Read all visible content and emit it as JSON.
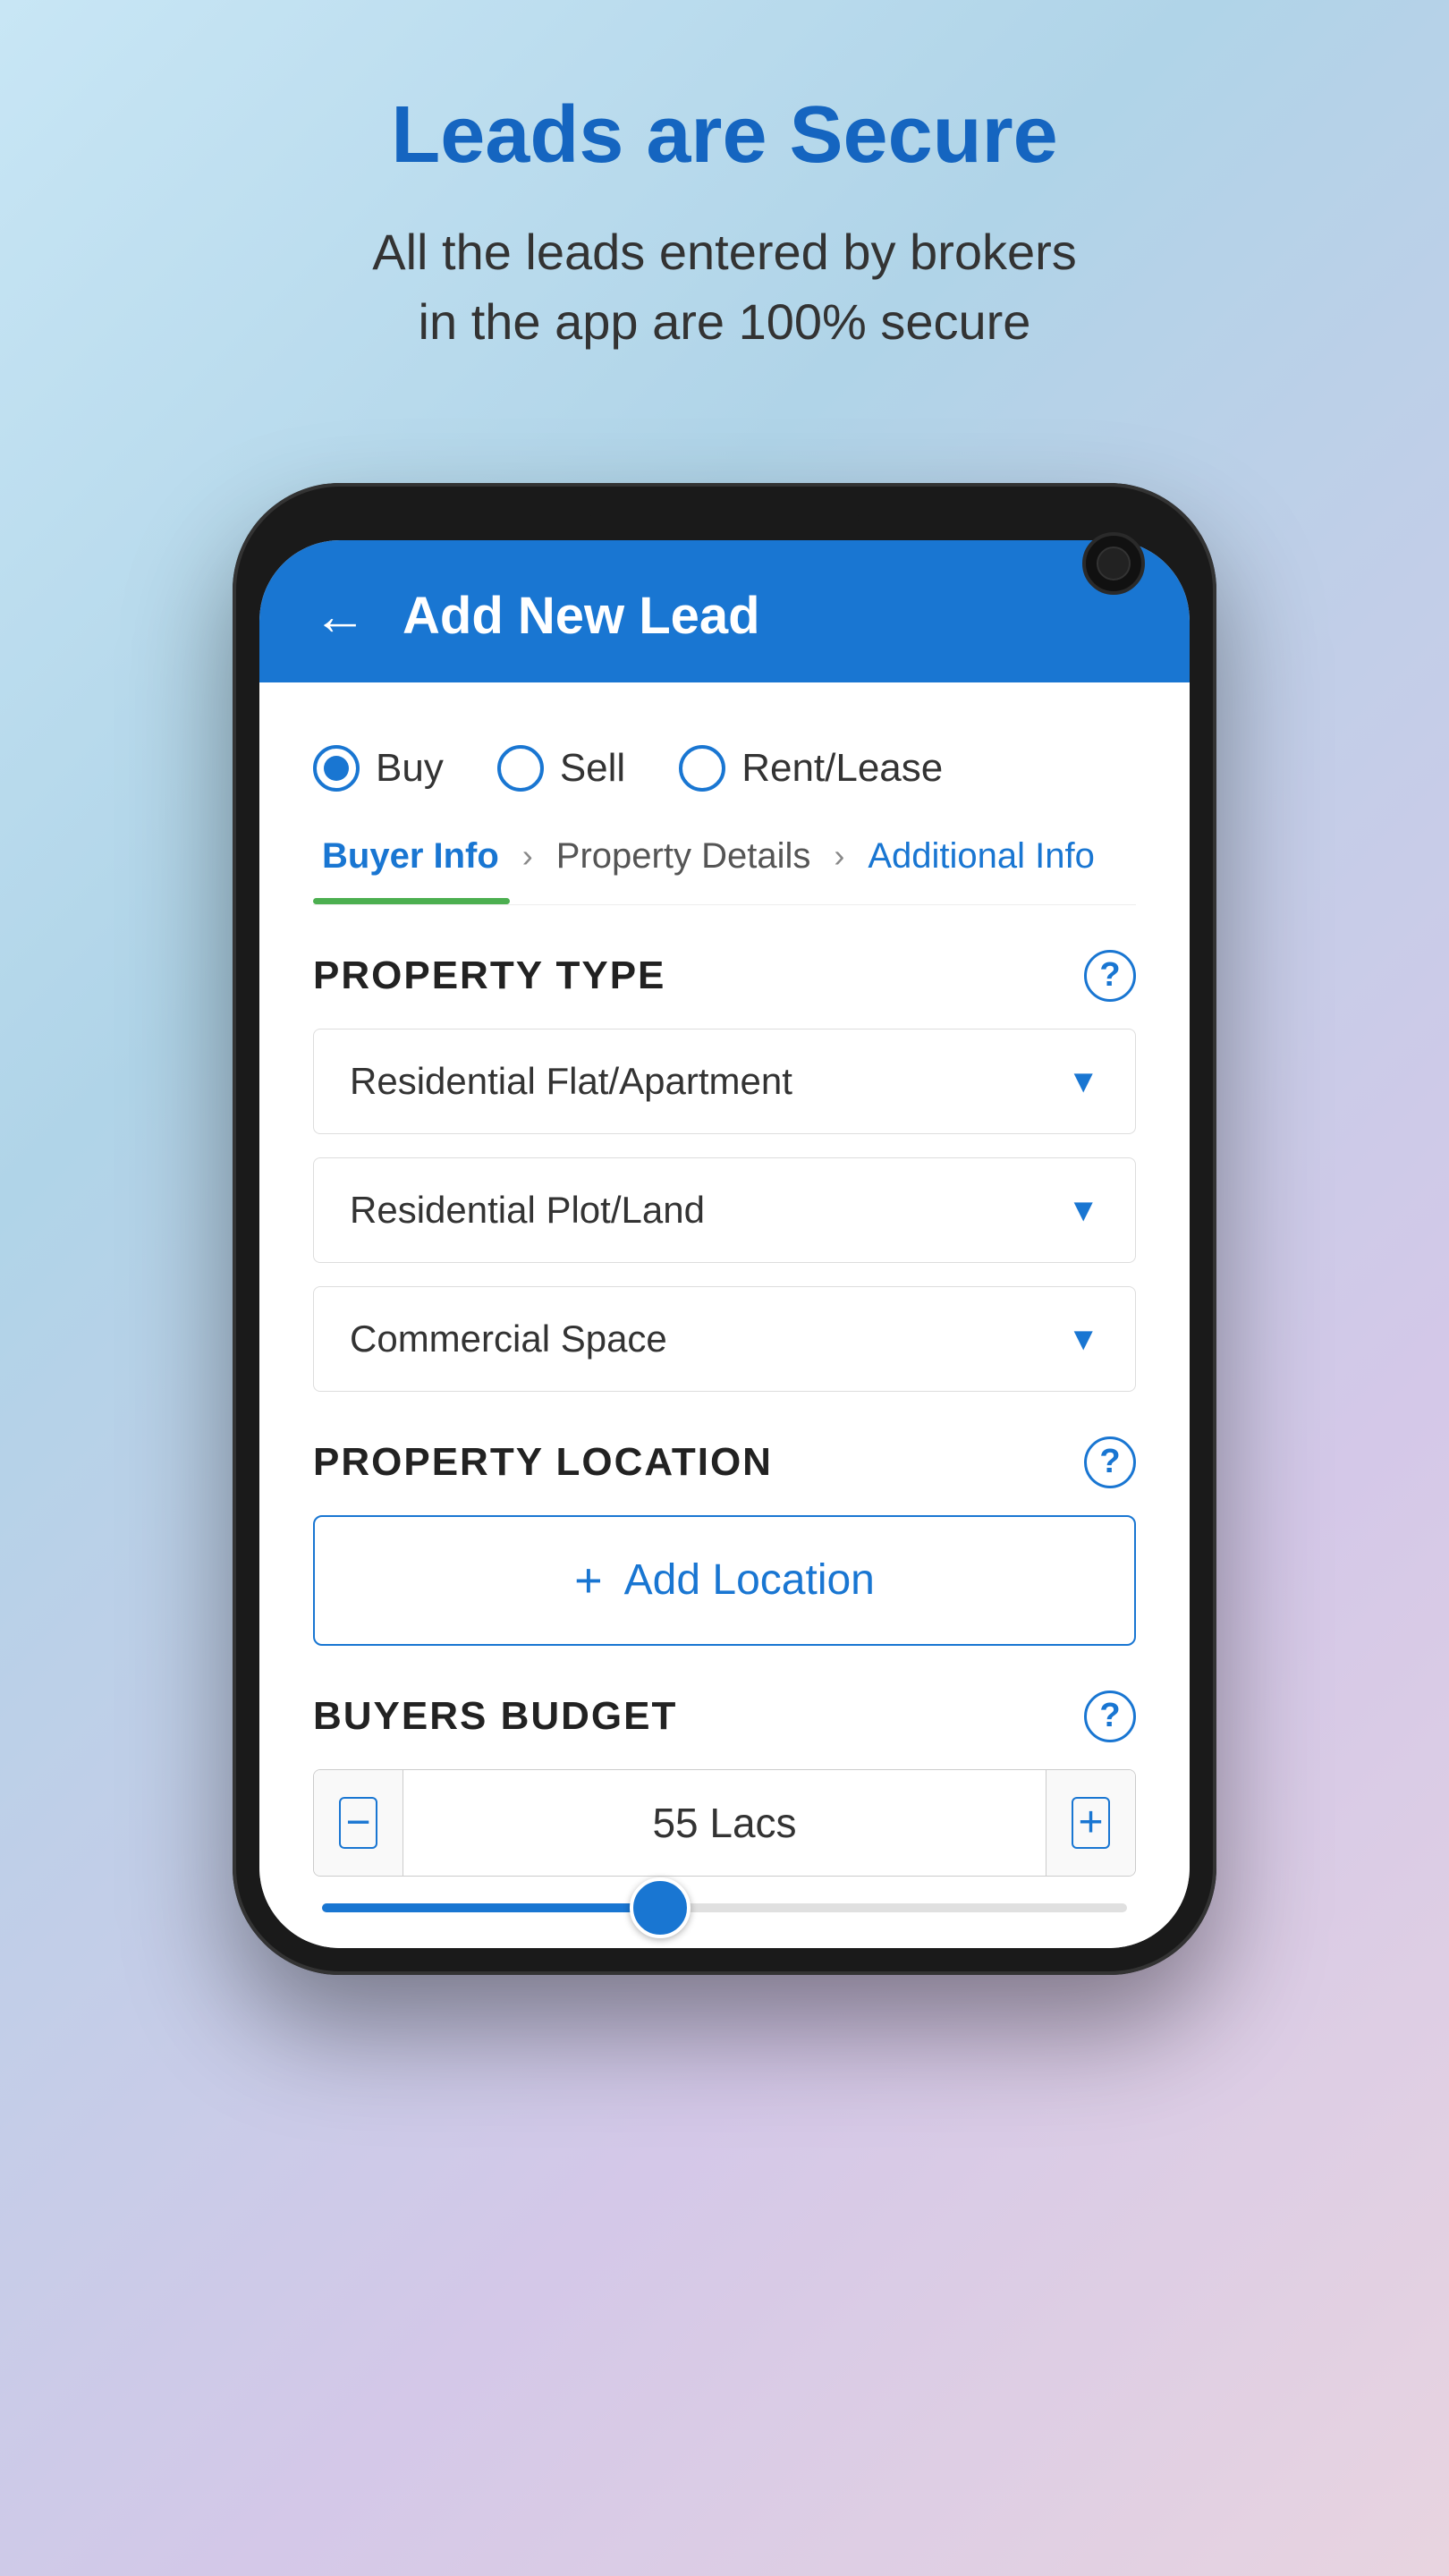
{
  "page": {
    "background": "gradient-light-blue",
    "headline": "Leads are Secure",
    "subtitle": "All the leads entered by brokers\nin the app are 100% secure"
  },
  "app": {
    "header": {
      "title": "Add New Lead",
      "back_label": "←"
    },
    "transaction_types": [
      {
        "id": "buy",
        "label": "Buy",
        "selected": true
      },
      {
        "id": "sell",
        "label": "Sell",
        "selected": false
      },
      {
        "id": "rent_lease",
        "label": "Rent/Lease",
        "selected": false
      }
    ],
    "tabs": [
      {
        "id": "buyer_info",
        "label": "Buyer Info",
        "state": "active"
      },
      {
        "id": "property_details",
        "label": "Property Details",
        "state": "inactive"
      },
      {
        "id": "additional_info",
        "label": "Additional Info",
        "state": "highlight"
      }
    ],
    "property_type": {
      "section_title": "PROPERTY TYPE",
      "help_icon": "?",
      "dropdowns": [
        {
          "label": "Residential Flat/Apartment"
        },
        {
          "label": "Residential Plot/Land"
        },
        {
          "label": "Commercial Space"
        }
      ]
    },
    "property_location": {
      "section_title": "PROPERTY LOCATION",
      "help_icon": "?",
      "add_button_label": "Add Location"
    },
    "buyers_budget": {
      "section_title": "BUYERS BUDGET",
      "help_icon": "?",
      "value": "55 Lacs",
      "slider_percent": 42,
      "decrement_icon": "−",
      "increment_icon": "+"
    }
  }
}
